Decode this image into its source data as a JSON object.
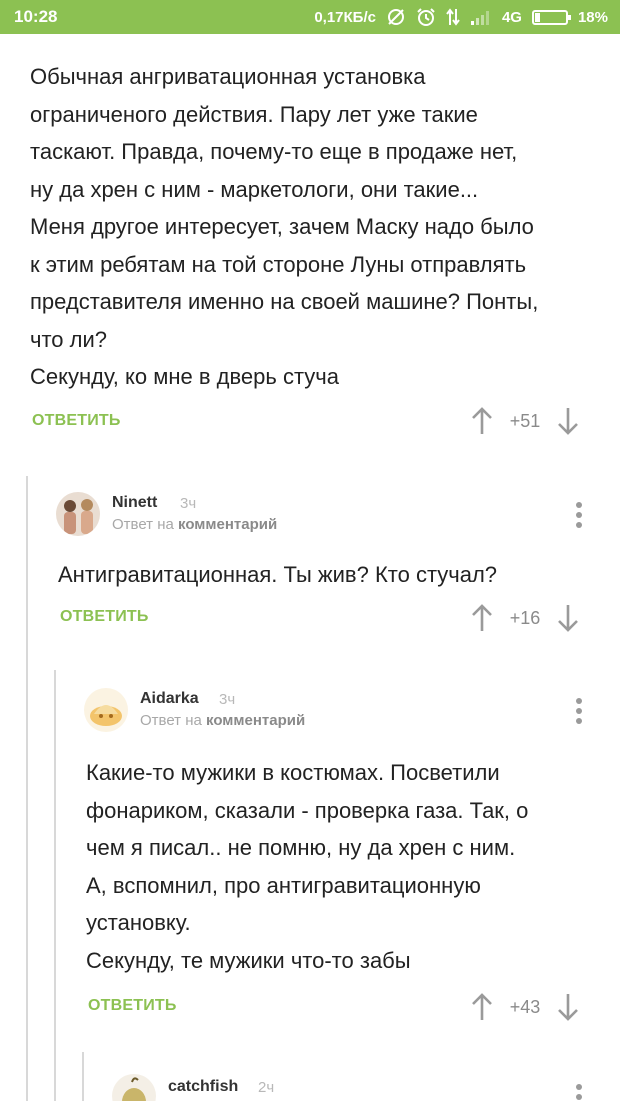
{
  "status_bar": {
    "time": "10:28",
    "speed": "0,17КБ/с",
    "network": "4G",
    "battery": "18%",
    "battery_level": 0.18,
    "icons": [
      "sync-off-icon",
      "alarm-icon",
      "data-arrows-icon",
      "signal-icon",
      "battery-icon"
    ]
  },
  "comments": [
    {
      "lines": [
        "Обычная ангриватационная установка",
        "ограниченого действия. Пару лет уже такие",
        "таскают. Правда, почему-то еще в продаже нет,",
        "ну да хрен с ним - маркетологи, они такие...",
        "Меня другое интересует, зачем Маску надо было",
        "к этим ребятам на той стороне Луны отправлять",
        "представителя именно на своей машине? Понты,",
        "что ли?",
        "Секунду, ко мне в дверь стуча"
      ],
      "reply_label": "ОТВЕТИТЬ",
      "score": "+51"
    },
    {
      "author": "Ninett",
      "time": "3ч",
      "reply_prefix": "Ответ на",
      "reply_target": "комментарий",
      "lines": [
        "Антигравитационная. Ты жив? Кто стучал?"
      ],
      "reply_label": "ОТВЕТИТЬ",
      "score": "+16"
    },
    {
      "author": "Aidarka",
      "time": "3ч",
      "reply_prefix": "Ответ на",
      "reply_target": "комментарий",
      "lines": [
        "Какие-то мужики в костюмах. Посветили",
        "фонариком, сказали - проверка газа. Так, о",
        "чем я писал.. не помню, ну да хрен с ним.",
        "А, вспомнил, про антигравитационную",
        "установку.",
        "Секунду, те мужики что-то забы"
      ],
      "reply_label": "ОТВЕТИТЬ",
      "score": "+43"
    },
    {
      "author": "catchfish",
      "time": "2ч"
    }
  ],
  "colors": {
    "accent": "#8cc152",
    "thread_line": "#d8d8d8",
    "muted": "#9a9a9a"
  }
}
